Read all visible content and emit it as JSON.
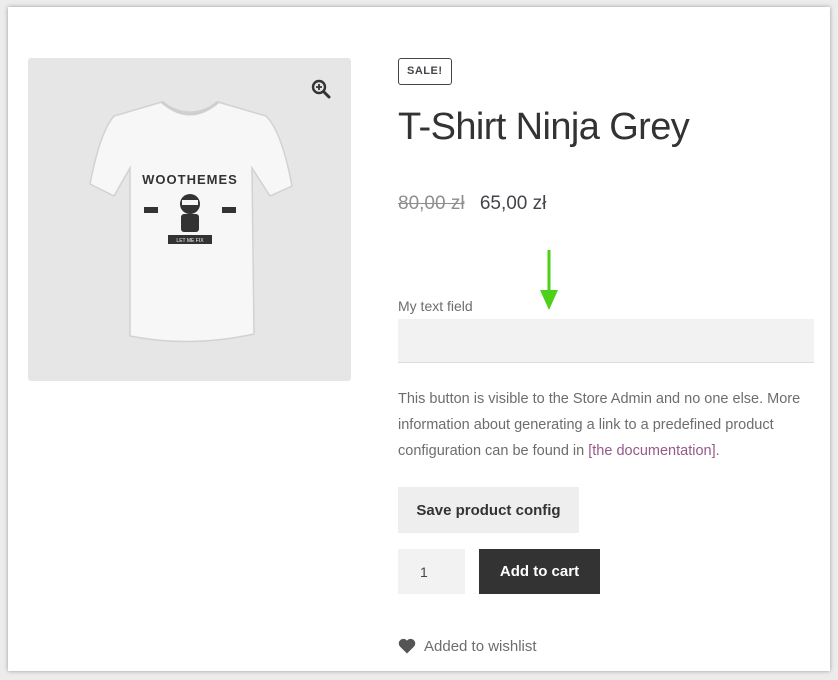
{
  "product": {
    "sale_badge": "SALE!",
    "title": "T-Shirt Ninja Grey",
    "price_old": "80,00 zł",
    "price_new": "65,00 zł",
    "image_text": "WOOTHEMES",
    "image_ribbon": "LET ME FIX"
  },
  "custom_field": {
    "label": "My text field",
    "value": ""
  },
  "notice": {
    "text": "This button is visible to the Store Admin and no one else. More information about generating a link to a predefined product configuration can be found in ",
    "link": "[the documentation]",
    "end": "."
  },
  "buttons": {
    "save_config": "Save product config",
    "add_to_cart": "Add to cart"
  },
  "quantity": {
    "value": "1"
  },
  "wishlist": {
    "label": "Added to wishlist"
  },
  "icons": {
    "zoom": "magnifier-plus-icon",
    "wishlist": "heart-icon",
    "annotation": "arrow-down-icon"
  },
  "colors": {
    "annotation_arrow": "#4cd11b",
    "link": "#96588a",
    "primary_button": "#333333"
  }
}
